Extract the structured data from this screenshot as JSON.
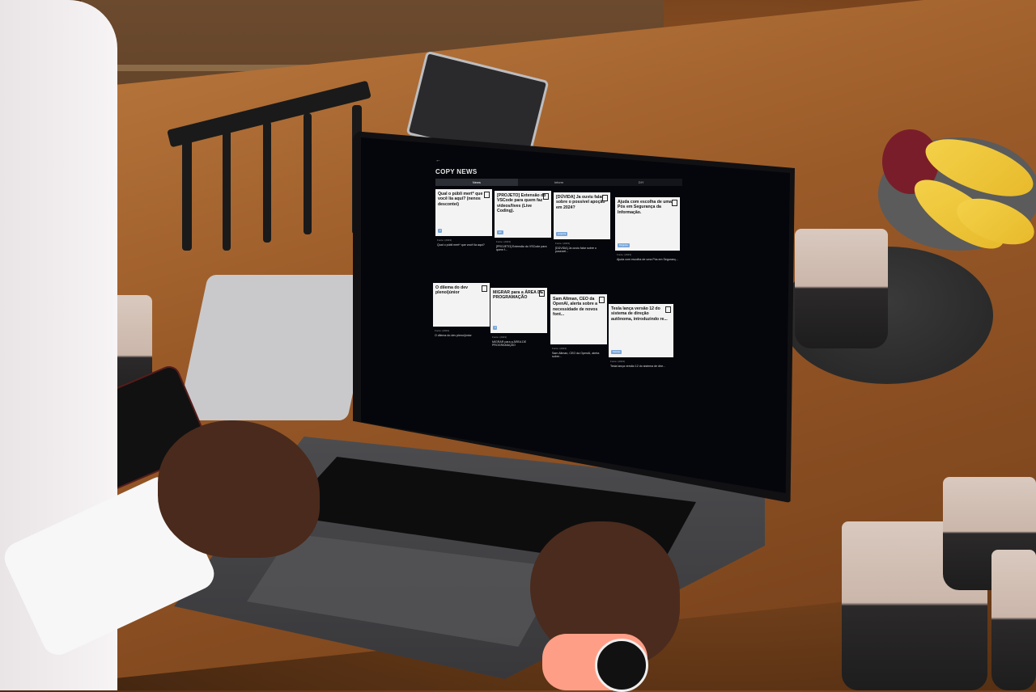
{
  "app": {
    "back_glyph": "←",
    "title": "COPY NEWS",
    "subtitle": "",
    "tabs": [
      {
        "label": "News",
        "active": true
      },
      {
        "label": "Inform",
        "active": false
      },
      {
        "label": "DIY",
        "active": false
      }
    ],
    "cards": [
      {
        "headline": "Qual o públi mert* que você lia aqui? (nenos descontei)",
        "pill": "tf",
        "meta": "Fonte: (2023)",
        "snippet": "Qual o públi mert* que você lia aqui?"
      },
      {
        "headline": "[PROJETO] Extensão do VSCode para quem faz vídeos/lives (Live Coding).",
        "pill": "tab",
        "meta": "Fonte: (2023)",
        "snippet": "[PROJETO] Extensão do VSCode para quem f..."
      },
      {
        "headline": "[DÚVIDA] Ja ouviu falar sobre o possível apoção em 2024?",
        "pill": "pergunta",
        "meta": "Fonte: (2023)",
        "snippet": "[DÚVIDA] Ja ouviu falar sobre o possível..."
      },
      {
        "headline": "Ajuda com escolha de uma Pós em Segurança da Informação.",
        "pill": "Pergunta",
        "meta": "Fonte: (2023)",
        "snippet": "Ajuda com escolha de uma Pós em Seguranç..."
      },
      {
        "headline": "O dilema do dev pleno/júnior",
        "pill": "",
        "meta": "Fonte: (2023)",
        "snippet": "O dilema do dev pleno/júnior"
      },
      {
        "headline": "MIGRAR para a ÁREA DE PROGRAMAÇÃO",
        "pill": "tf",
        "meta": "Fonte: (2023)",
        "snippet": "MIGRAR para a ÁREA DE PROGRAMAÇÃO"
      },
      {
        "headline": "Sam Altman, CEO da OpenAI, alerta sobre a necessidade de novos font...",
        "pill": "",
        "meta": "Fonte: (2023)",
        "snippet": "Sam Altman, CEO da OpenAI, alerta sobre..."
      },
      {
        "headline": "Tesla lança versão 12 do sistema de direção autônoma, introduzindo re...",
        "pill": "Notícias",
        "meta": "Fonte: (2023)",
        "snippet": "Tesla lança versão 12 do sistema de dire..."
      }
    ]
  }
}
